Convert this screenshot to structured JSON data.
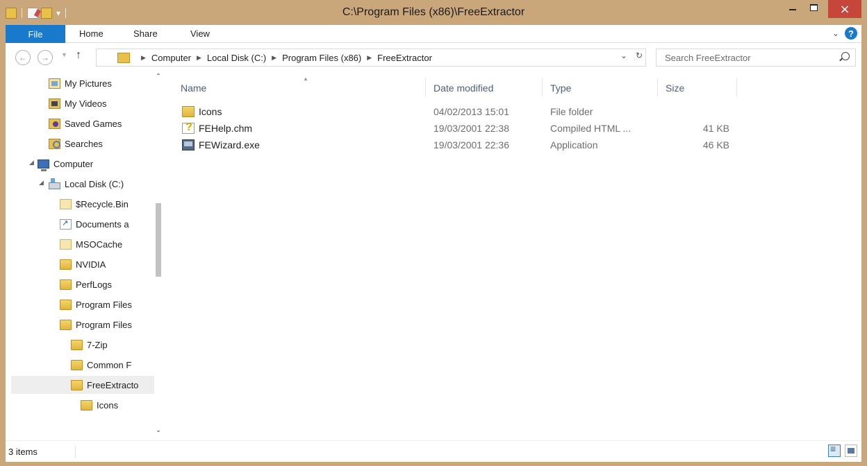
{
  "window": {
    "title": "C:\\Program Files (x86)\\FreeExtractor",
    "close_glyph": "×",
    "accent": "#c9a77a",
    "close_color": "#c7463c"
  },
  "ribbon": {
    "file_tab": "File",
    "tabs": [
      "Home",
      "Share",
      "View"
    ],
    "file_color": "#1979ca"
  },
  "address": {
    "crumbs": [
      "Computer",
      "Local Disk (C:)",
      "Program Files (x86)",
      "FreeExtractor"
    ],
    "search_placeholder": "Search FreeExtractor"
  },
  "navigation": {
    "items": [
      {
        "label": "My Pictures",
        "icon": "pictures-icon"
      },
      {
        "label": "My Videos",
        "icon": "videos-icon"
      },
      {
        "label": "Saved Games",
        "icon": "saved-games-icon"
      },
      {
        "label": "Searches",
        "icon": "searches-icon"
      },
      {
        "label": "Computer",
        "icon": "computer-icon"
      },
      {
        "label": "Local Disk (C:)",
        "icon": "local-disk-icon"
      },
      {
        "label": "$Recycle.Bin",
        "icon": "folder-icon"
      },
      {
        "label": "Documents a",
        "icon": "shortcut-folder-icon"
      },
      {
        "label": "MSOCache",
        "icon": "folder-icon"
      },
      {
        "label": "NVIDIA",
        "icon": "folder-icon"
      },
      {
        "label": "PerfLogs",
        "icon": "folder-icon"
      },
      {
        "label": "Program Files",
        "icon": "folder-icon"
      },
      {
        "label": "Program Files",
        "icon": "folder-icon"
      },
      {
        "label": "7-Zip",
        "icon": "folder-icon"
      },
      {
        "label": "Common F",
        "icon": "folder-icon"
      },
      {
        "label": "FreeExtracto",
        "icon": "folder-icon"
      },
      {
        "label": "Icons",
        "icon": "folder-icon"
      }
    ],
    "selected_label": "FreeExtracto"
  },
  "filelist": {
    "columns": {
      "name": "Name",
      "date": "Date modified",
      "type": "Type",
      "size": "Size"
    },
    "rows": [
      {
        "name": "Icons",
        "date": "04/02/2013 15:01",
        "type": "File folder",
        "size": "",
        "icon": "folder-icon"
      },
      {
        "name": "FEHelp.chm",
        "date": "19/03/2001 22:38",
        "type": "Compiled HTML ...",
        "size": "41 KB",
        "icon": "help-file-icon"
      },
      {
        "name": "FEWizard.exe",
        "date": "19/03/2001 22:36",
        "type": "Application",
        "size": "46 KB",
        "icon": "application-icon"
      }
    ]
  },
  "status": {
    "item_count": "3 items"
  }
}
